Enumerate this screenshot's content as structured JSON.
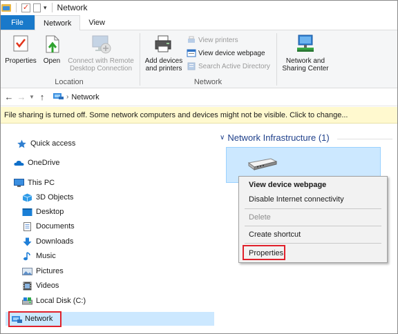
{
  "window": {
    "title": "Network"
  },
  "tabs": [
    {
      "label": "File"
    },
    {
      "label": "Network"
    },
    {
      "label": "View"
    }
  ],
  "ribbon": {
    "location_group": {
      "label": "Location",
      "properties": "Properties",
      "open": "Open",
      "remote_line1": "Connect with Remote",
      "remote_line2": "Desktop Connection"
    },
    "network_group": {
      "label": "Network",
      "add_devices_line1": "Add devices",
      "add_devices_line2": "and printers",
      "view_printers": "View printers",
      "view_device_webpage": "View device webpage",
      "search_ad": "Search Active Directory"
    },
    "sharing_group": {
      "line1": "Network and",
      "line2": "Sharing Center"
    }
  },
  "address": {
    "crumb": "Network"
  },
  "infobar": {
    "text": "File sharing is turned off. Some network computers and devices might not be visible. Click to change..."
  },
  "nav": {
    "quick_access": "Quick access",
    "onedrive": "OneDrive",
    "this_pc": "This PC",
    "children": [
      "3D Objects",
      "Desktop",
      "Documents",
      "Downloads",
      "Music",
      "Pictures",
      "Videos",
      "Local Disk (C:)"
    ],
    "network": "Network"
  },
  "content": {
    "group_header": "Network Infrastructure (1)"
  },
  "context_menu": {
    "items": [
      "View device webpage",
      "Disable Internet connectivity",
      "Delete",
      "Create shortcut",
      "Properties"
    ]
  },
  "colors": {
    "accent": "#1979ca",
    "selection": "#cce8ff",
    "highlight_box": "#e0202a",
    "infobar": "#fff9cf"
  }
}
